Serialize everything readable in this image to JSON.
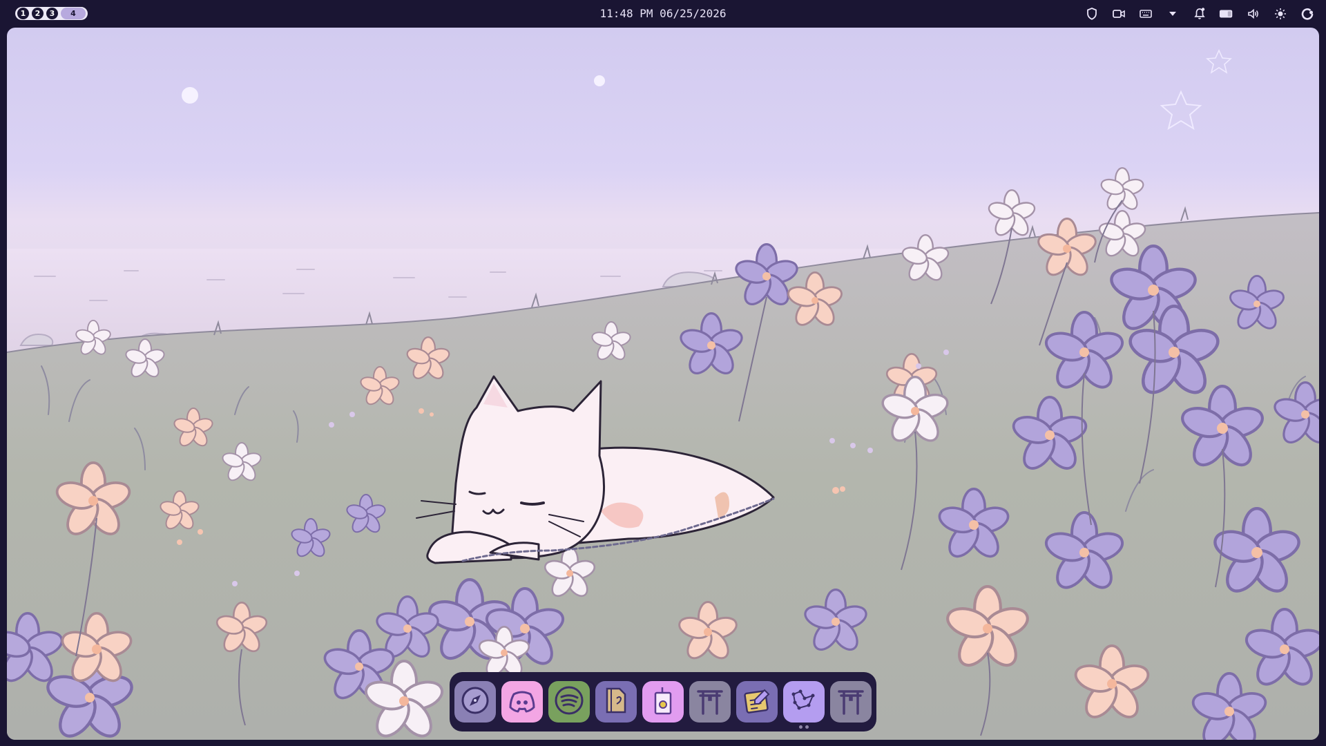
{
  "topbar": {
    "workspaces": [
      "1",
      "2",
      "3",
      "4"
    ],
    "active_workspace": "4",
    "clock": "11:48 PM 06/25/2026",
    "tray_icons": [
      "shield-icon",
      "screen-record-icon",
      "keyboard-icon",
      "dropdown-arrow-icon",
      "notification-bell-icon",
      "battery-icon",
      "volume-icon",
      "brightness-icon",
      "power-icon"
    ]
  },
  "dock": {
    "apps": [
      {
        "name": "compass-icon",
        "color": "#8a80b4",
        "active": false
      },
      {
        "name": "discord-icon",
        "color": "#f3a6e4",
        "active": false
      },
      {
        "name": "spotify-icon",
        "color": "#79a15e",
        "active": false
      },
      {
        "name": "file-manager-icon",
        "color": "#7a6eb3",
        "active": false
      },
      {
        "name": "app-store-icon",
        "color": "#e19cf0",
        "active": true
      },
      {
        "name": "torii-gate-icon",
        "color": "#8a85a0",
        "active": false
      },
      {
        "name": "notes-icon",
        "color": "#7a6eb3",
        "active": false
      },
      {
        "name": "constellation-icon",
        "color": "#b49df0",
        "active": false
      },
      {
        "name": "torii-gate-icon",
        "color": "#8a85a0",
        "active": false
      }
    ]
  },
  "colors": {
    "bar_background": "#1a1533",
    "sky": "#d2cbf0",
    "meadow": "#b2b6ae",
    "accent_purple": "#b7a9de"
  }
}
